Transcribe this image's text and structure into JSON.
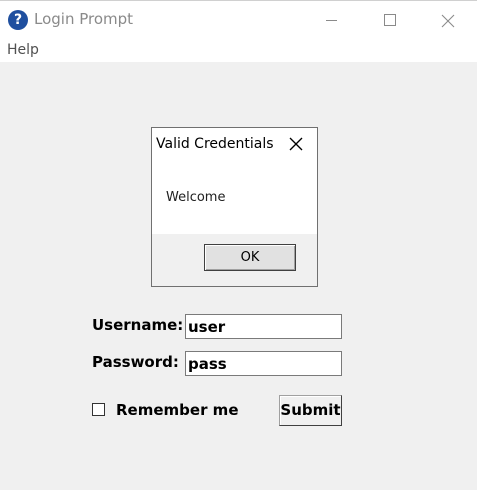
{
  "window": {
    "title": "Login Prompt",
    "icon": "help-question-icon"
  },
  "menubar": {
    "items": [
      "Help"
    ]
  },
  "dialog": {
    "title": "Valid Credentials",
    "message": "Welcome",
    "ok_label": "OK"
  },
  "form": {
    "username_label": "Username:",
    "username_value": "user",
    "password_label": "Password:",
    "password_value": "pass",
    "remember_label": "Remember me",
    "remember_checked": false,
    "submit_label": "Submit"
  },
  "colors": {
    "client_background": "#f0f0f0",
    "title_text": "#8a8a8a",
    "icon_blue": "#1f4f9f"
  }
}
